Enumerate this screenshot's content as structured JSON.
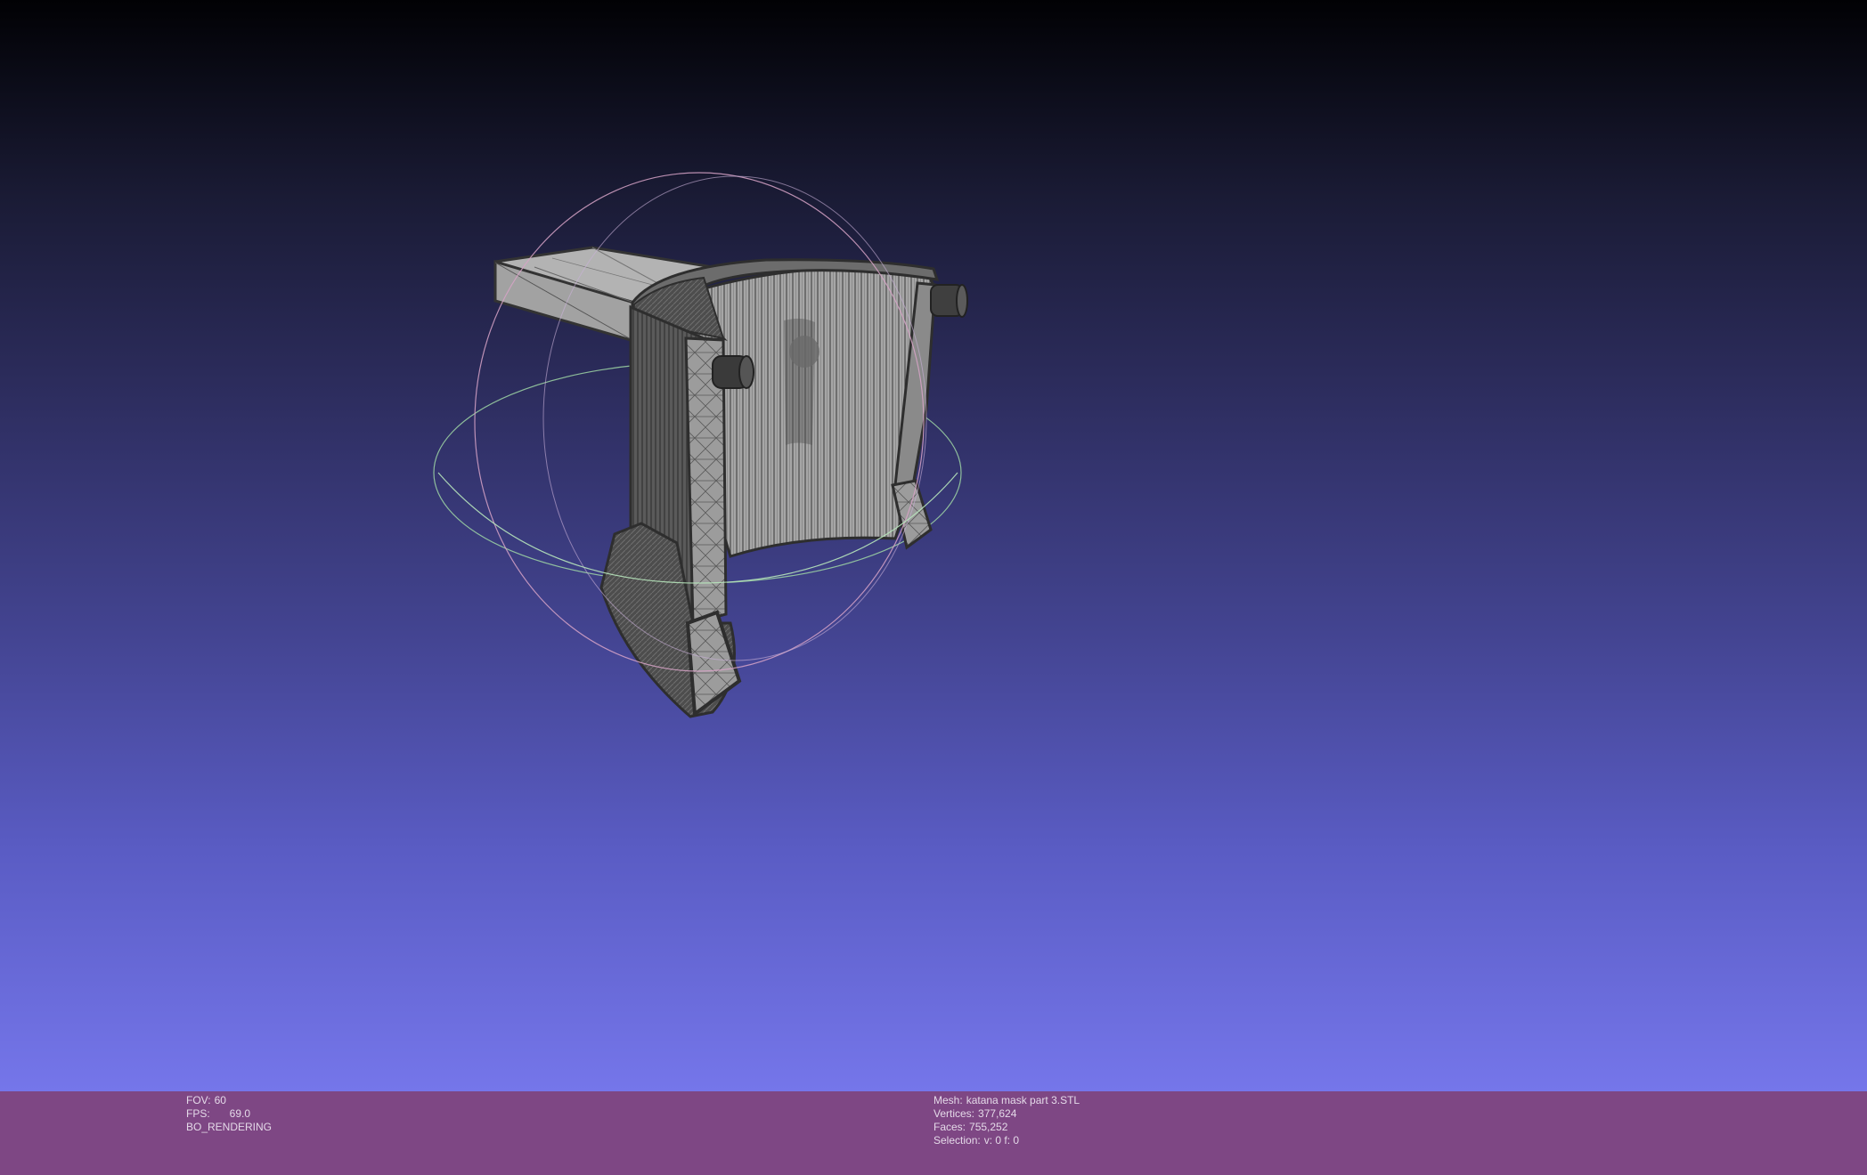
{
  "viewport": {
    "background_top": "#010104",
    "background_bottom": "#7576ea",
    "mesh_color": "#a9a9a9",
    "edge_color": "#3b3b3b",
    "trackball_colors": {
      "horizontal_ring": "#9fd6a4",
      "vertical_ring": "#d7a3c7",
      "side_ring": "#c9b0d8"
    }
  },
  "infobar": {
    "background": "#7e4784",
    "left": {
      "fov_label": "FOV:",
      "fov_value": "60",
      "fps_label": "FPS:",
      "fps_value": "69.0",
      "render_mode": "BO_RENDERING"
    },
    "right": {
      "mesh_label": "Mesh:",
      "mesh_value": "katana mask part 3.STL",
      "vertices_label": "Vertices:",
      "vertices_value": "377,624",
      "faces_label": "Faces:",
      "faces_value": "755,252",
      "selection_label": "Selection:",
      "selection_value": "v: 0 f: 0"
    }
  }
}
